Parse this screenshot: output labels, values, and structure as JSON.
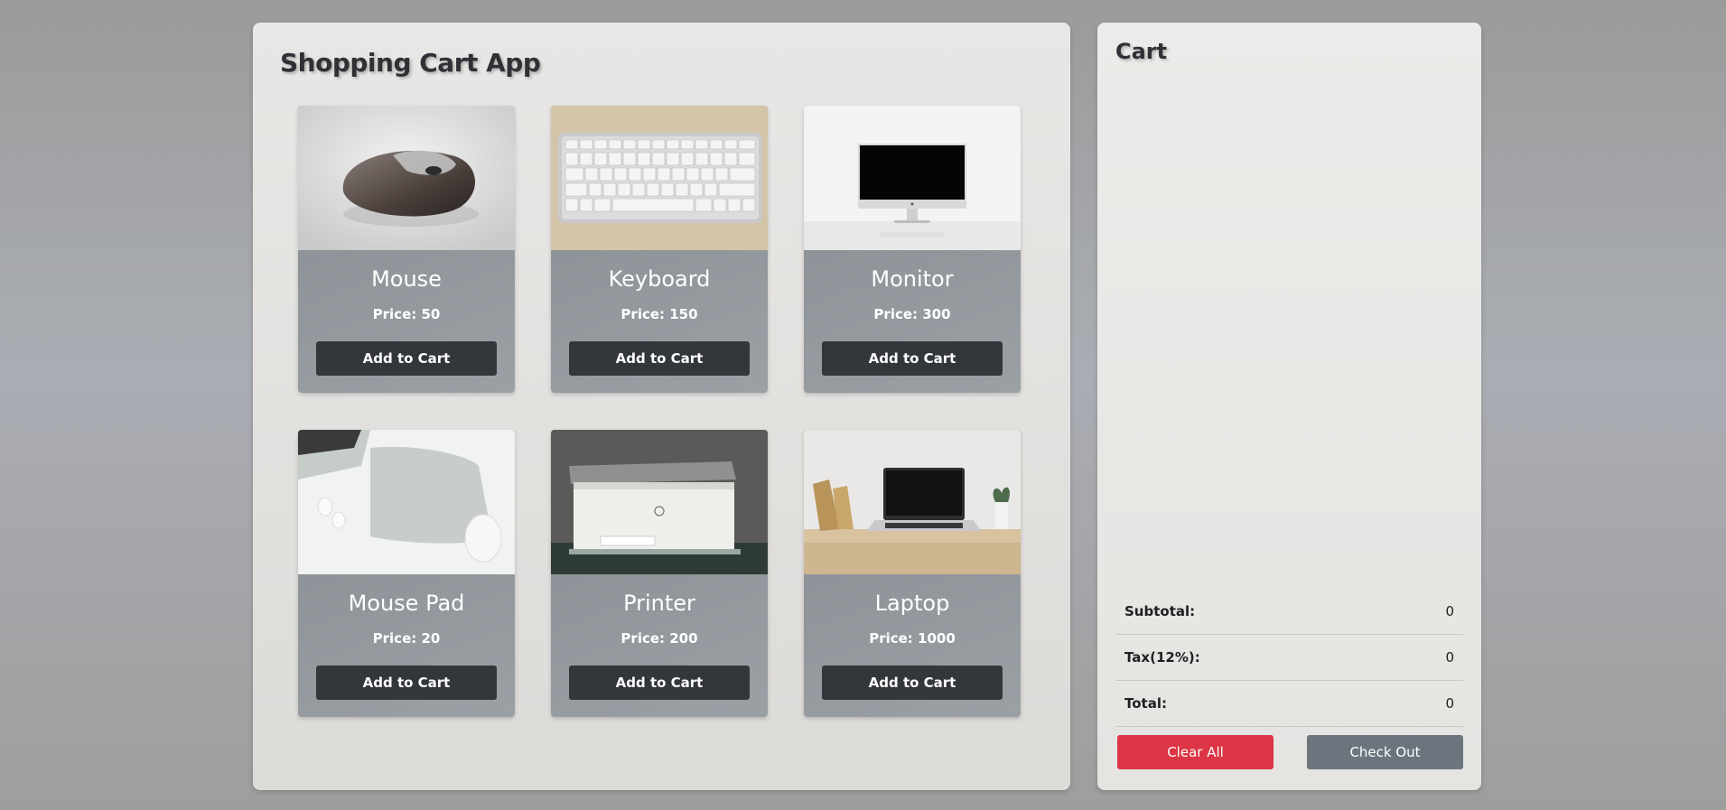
{
  "app": {
    "title": "Shopping Cart App"
  },
  "products": [
    {
      "name": "Mouse",
      "price": "Price: 50",
      "button": "Add to Cart",
      "icon": "mouse-photo"
    },
    {
      "name": "Keyboard",
      "price": "Price: 150",
      "button": "Add to Cart",
      "icon": "keyboard-photo"
    },
    {
      "name": "Monitor",
      "price": "Price: 300",
      "button": "Add to Cart",
      "icon": "monitor-photo"
    },
    {
      "name": "Mouse Pad",
      "price": "Price: 20",
      "button": "Add to Cart",
      "icon": "mouse-pad-photo"
    },
    {
      "name": "Printer",
      "price": "Price: 200",
      "button": "Add to Cart",
      "icon": "printer-photo"
    },
    {
      "name": "Laptop",
      "price": "Price: 1000",
      "button": "Add to Cart",
      "icon": "laptop-photo"
    }
  ],
  "cart": {
    "title": "Cart",
    "subtotal_label": "Subtotal:",
    "subtotal_value": "0",
    "tax_label": "Tax(12%):",
    "tax_value": "0",
    "total_label": "Total:",
    "total_value": "0",
    "clear_label": "Clear All",
    "checkout_label": "Check Out"
  },
  "colors": {
    "accent_danger": "#dc3545",
    "accent_secondary": "#6c757d",
    "button_dark": "#33363b"
  }
}
